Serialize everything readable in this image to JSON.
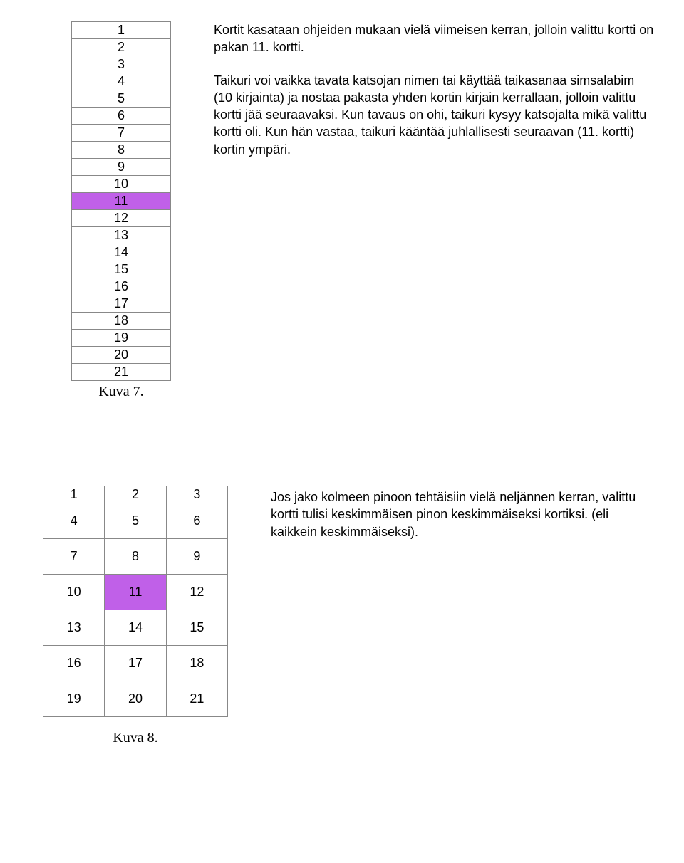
{
  "figure1": {
    "cells": [
      "1",
      "2",
      "3",
      "4",
      "5",
      "6",
      "7",
      "8",
      "9",
      "10",
      "11",
      "12",
      "13",
      "14",
      "15",
      "16",
      "17",
      "18",
      "19",
      "20",
      "21"
    ],
    "highlight_index": 10,
    "caption": "Kuva 7."
  },
  "text1": {
    "p1": "Kortit kasataan ohjeiden mukaan vielä viimeisen kerran, jolloin valittu kortti on pakan 11. kortti.",
    "p2": "Taikuri voi vaikka tavata katsojan nimen tai käyttää taikasanaa simsalabim (10 kirjainta) ja nostaa pakasta yhden kortin kirjain kerrallaan, jolloin valittu kortti jää seuraavaksi. Kun tavaus on ohi, taikuri kysyy katsojalta mikä valittu kortti oli. Kun hän vastaa, taikuri kääntää juhlallisesti seuraavan (11. kortti) kortin ympäri."
  },
  "figure2": {
    "rows": [
      [
        "1",
        "2",
        "3"
      ],
      [
        "4",
        "5",
        "6"
      ],
      [
        "7",
        "8",
        "9"
      ],
      [
        "10",
        "11",
        "12"
      ],
      [
        "13",
        "14",
        "15"
      ],
      [
        "16",
        "17",
        "18"
      ],
      [
        "19",
        "20",
        "21"
      ]
    ],
    "highlight": {
      "row": 3,
      "col": 1
    },
    "caption": "Kuva 8."
  },
  "text2": {
    "p1": "Jos jako kolmeen pinoon tehtäisiin vielä neljännen kerran, valittu kortti tulisi keskimmäisen pinon keskimmäiseksi kortiksi. (eli kaikkein keskimmäiseksi)."
  }
}
